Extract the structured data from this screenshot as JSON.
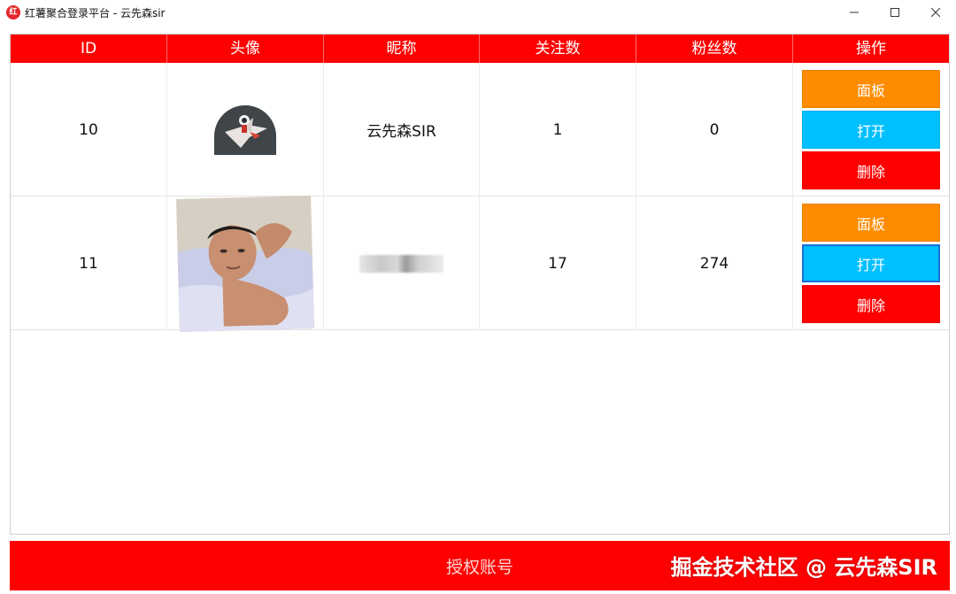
{
  "window": {
    "title": "红薯聚合登录平台 - 云先森sir",
    "app_icon_text": "红"
  },
  "table": {
    "headers": [
      "ID",
      "头像",
      "昵称",
      "关注数",
      "粉丝数",
      "操作"
    ],
    "rows": [
      {
        "id": "10",
        "nickname": "云先森SIR",
        "following": "1",
        "followers": "0"
      },
      {
        "id": "11",
        "nickname": "",
        "following": "17",
        "followers": "274"
      }
    ],
    "actions": {
      "panel": "面板",
      "open": "打开",
      "delete": "删除"
    }
  },
  "footer": {
    "label": "授权账号",
    "watermark": "掘金技术社区 @ 云先森SIR"
  },
  "colors": {
    "header_red": "#ff0000",
    "panel_orange": "#ff8c00",
    "open_blue": "#00bfff",
    "delete_red": "#ff0000"
  },
  "icons": {
    "minimize": "minimize-icon",
    "maximize": "maximize-icon",
    "close": "close-icon"
  }
}
